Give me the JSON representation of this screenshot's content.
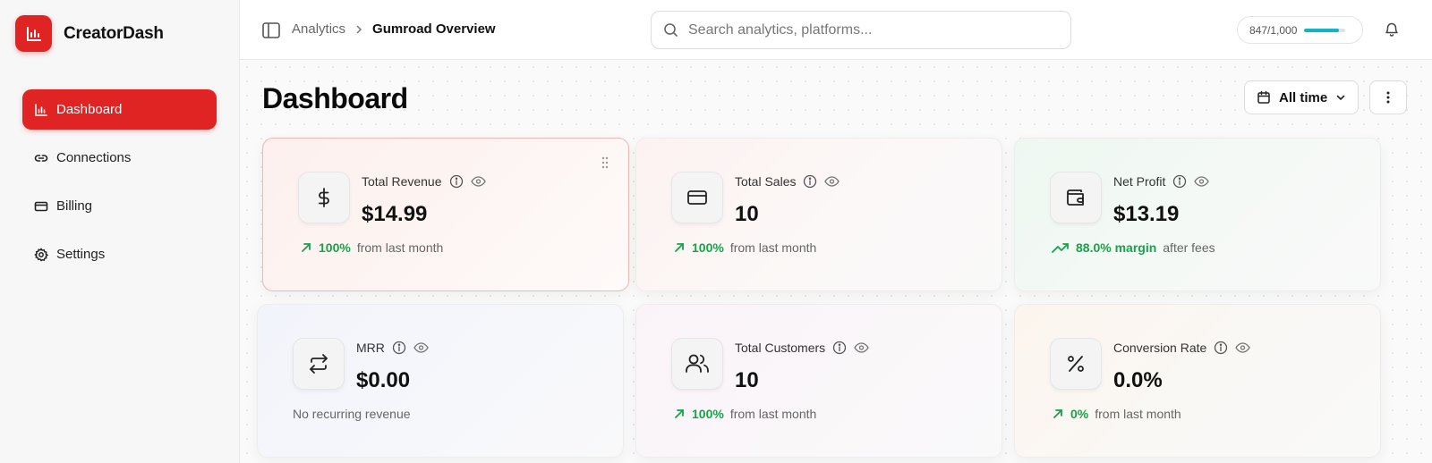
{
  "brand": {
    "name": "CreatorDash"
  },
  "sidebar": {
    "items": [
      {
        "label": "Dashboard",
        "icon": "bar-chart-icon",
        "active": true
      },
      {
        "label": "Connections",
        "icon": "link-icon",
        "active": false
      },
      {
        "label": "Billing",
        "icon": "credit-card-icon",
        "active": false
      },
      {
        "label": "Settings",
        "icon": "gear-icon",
        "active": false
      }
    ]
  },
  "header": {
    "breadcrumb_parent": "Analytics",
    "breadcrumb_current": "Gumroad Overview",
    "search_placeholder": "Search analytics, platforms...",
    "usage_text": "847/1,000",
    "usage_fraction": 0.847
  },
  "main": {
    "title": "Dashboard",
    "range_label": "All time"
  },
  "cards": [
    {
      "label": "Total Revenue",
      "value": "$14.99",
      "trend": "100%",
      "trend_suffix": "from last month",
      "icon": "dollar-icon"
    },
    {
      "label": "Total Sales",
      "value": "10",
      "trend": "100%",
      "trend_suffix": "from last month",
      "icon": "card-icon"
    },
    {
      "label": "Net Profit",
      "value": "$13.19",
      "trend": "88.0% margin",
      "trend_suffix": "after fees",
      "icon": "wallet-icon"
    },
    {
      "label": "MRR",
      "value": "$0.00",
      "trend": "",
      "trend_suffix": "No recurring revenue",
      "icon": "repeat-icon"
    },
    {
      "label": "Total Customers",
      "value": "10",
      "trend": "100%",
      "trend_suffix": "from last month",
      "icon": "users-icon"
    },
    {
      "label": "Conversion Rate",
      "value": "0.0%",
      "trend": "0%",
      "trend_suffix": "from last month",
      "icon": "percent-icon"
    }
  ],
  "colors": {
    "accent": "#e02424",
    "positive": "#16a34a",
    "usage": "#14b3c6"
  }
}
